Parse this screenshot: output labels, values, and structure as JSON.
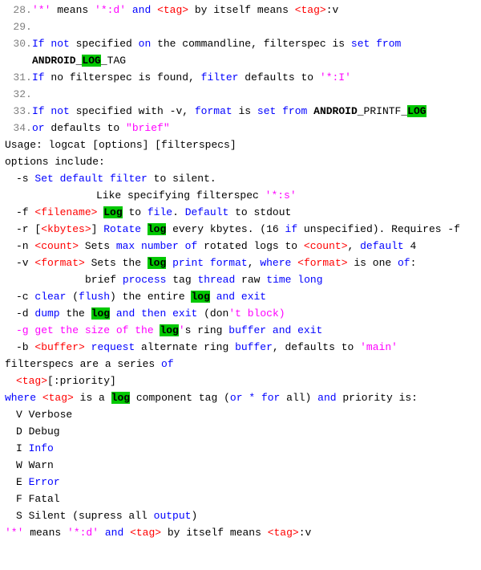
{
  "lines": [
    {
      "num": "28",
      "seg": [
        {
          "c": "str",
          "t": "'*'"
        },
        {
          "c": "plain",
          "t": " means "
        },
        {
          "c": "str",
          "t": "'*:d'"
        },
        {
          "c": "plain",
          "t": " "
        },
        {
          "c": "kw",
          "t": "and"
        },
        {
          "c": "plain",
          "t": " "
        },
        {
          "c": "tag",
          "t": "<tag>"
        },
        {
          "c": "plain",
          "t": " by itself means "
        },
        {
          "c": "tag",
          "t": "<tag>"
        },
        {
          "c": "plain",
          "t": ":v"
        }
      ]
    },
    {
      "num": "29",
      "seg": []
    },
    {
      "num": "30",
      "seg": [
        {
          "c": "kw",
          "t": "If"
        },
        {
          "c": "plain",
          "t": " "
        },
        {
          "c": "kw",
          "t": "not"
        },
        {
          "c": "plain",
          "t": " specified "
        },
        {
          "c": "kw",
          "t": "on"
        },
        {
          "c": "plain",
          "t": " the commandline, filterspec is "
        },
        {
          "c": "kw",
          "t": "set"
        },
        {
          "c": "plain",
          "t": " "
        },
        {
          "c": "kw",
          "t": "from"
        },
        {
          "c": "plain",
          "t": " "
        },
        {
          "c": "b",
          "t": "ANDROID_"
        },
        {
          "c": "hi",
          "t": "LOG"
        },
        {
          "c": "b",
          "t": "_"
        },
        {
          "c": "plain",
          "t": "TAG"
        }
      ]
    },
    {
      "num": "31",
      "seg": [
        {
          "c": "kw",
          "t": "If"
        },
        {
          "c": "plain",
          "t": " no filterspec is found, "
        },
        {
          "c": "kw",
          "t": "filter"
        },
        {
          "c": "plain",
          "t": " defaults to "
        },
        {
          "c": "str",
          "t": "'*:I'"
        }
      ]
    },
    {
      "num": "32",
      "seg": []
    },
    {
      "num": "33",
      "seg": [
        {
          "c": "kw",
          "t": "If"
        },
        {
          "c": "plain",
          "t": " "
        },
        {
          "c": "kw",
          "t": "not"
        },
        {
          "c": "plain",
          "t": " specified with -v, "
        },
        {
          "c": "kw",
          "t": "format"
        },
        {
          "c": "plain",
          "t": " is "
        },
        {
          "c": "kw",
          "t": "set"
        },
        {
          "c": "plain",
          "t": " "
        },
        {
          "c": "kw",
          "t": "from"
        },
        {
          "c": "plain",
          "t": " "
        },
        {
          "c": "b",
          "t": "ANDROID"
        },
        {
          "c": "plain",
          "t": "_PRINTF_"
        },
        {
          "c": "hi",
          "t": "LOG"
        }
      ]
    },
    {
      "num": "34",
      "seg": [
        {
          "c": "kw",
          "t": "or"
        },
        {
          "c": "plain",
          "t": " defaults to "
        },
        {
          "c": "dstr",
          "t": "\"brief\""
        }
      ]
    }
  ],
  "tail": [
    {
      "ind": "",
      "seg": [
        {
          "c": "plain",
          "t": "Usage: logcat [options] [filterspecs]"
        }
      ]
    },
    {
      "ind": "",
      "seg": [
        {
          "c": "plain",
          "t": "options include:"
        }
      ]
    },
    {
      "ind": "indent-1",
      "seg": [
        {
          "c": "plain",
          "t": "-s "
        },
        {
          "c": "kw",
          "t": "Set"
        },
        {
          "c": "plain",
          "t": " "
        },
        {
          "c": "kw",
          "t": "default"
        },
        {
          "c": "plain",
          "t": " "
        },
        {
          "c": "kw",
          "t": "filter"
        },
        {
          "c": "plain",
          "t": " to silent."
        }
      ]
    },
    {
      "ind": "indent-2",
      "seg": [
        {
          "c": "plain",
          "t": "Like specifying filterspec "
        },
        {
          "c": "str",
          "t": "'*:s'"
        }
      ]
    },
    {
      "ind": "indent-1",
      "seg": [
        {
          "c": "plain",
          "t": "-f "
        },
        {
          "c": "tag",
          "t": "<filename>"
        },
        {
          "c": "plain",
          "t": " "
        },
        {
          "c": "hi",
          "t": "Log"
        },
        {
          "c": "plain",
          "t": " to "
        },
        {
          "c": "kw",
          "t": "file"
        },
        {
          "c": "plain",
          "t": ". "
        },
        {
          "c": "kw",
          "t": "Default"
        },
        {
          "c": "plain",
          "t": " to stdout"
        }
      ]
    },
    {
      "ind": "indent-1",
      "seg": [
        {
          "c": "plain",
          "t": "-r ["
        },
        {
          "c": "tag",
          "t": "<kbytes>"
        },
        {
          "c": "plain",
          "t": "] "
        },
        {
          "c": "kw",
          "t": "Rotate"
        },
        {
          "c": "plain",
          "t": " "
        },
        {
          "c": "hi",
          "t": "log"
        },
        {
          "c": "plain",
          "t": " every kbytes. (16 "
        },
        {
          "c": "kw",
          "t": "if"
        },
        {
          "c": "plain",
          "t": " unspecified). Requires -f"
        }
      ]
    },
    {
      "ind": "indent-1",
      "seg": [
        {
          "c": "plain",
          "t": "-n "
        },
        {
          "c": "tag",
          "t": "<count>"
        },
        {
          "c": "plain",
          "t": " Sets "
        },
        {
          "c": "kw",
          "t": "max"
        },
        {
          "c": "plain",
          "t": " "
        },
        {
          "c": "kw",
          "t": "number"
        },
        {
          "c": "plain",
          "t": " "
        },
        {
          "c": "kw",
          "t": "of"
        },
        {
          "c": "plain",
          "t": " rotated logs to "
        },
        {
          "c": "tag",
          "t": "<count>"
        },
        {
          "c": "plain",
          "t": ", "
        },
        {
          "c": "kw",
          "t": "default"
        },
        {
          "c": "plain",
          "t": " 4"
        }
      ]
    },
    {
      "ind": "indent-1",
      "seg": [
        {
          "c": "plain",
          "t": "-v "
        },
        {
          "c": "tag",
          "t": "<format>"
        },
        {
          "c": "plain",
          "t": " Sets the "
        },
        {
          "c": "hi",
          "t": "log"
        },
        {
          "c": "plain",
          "t": " "
        },
        {
          "c": "kw",
          "t": "print"
        },
        {
          "c": "plain",
          "t": " "
        },
        {
          "c": "kw",
          "t": "format"
        },
        {
          "c": "plain",
          "t": ", "
        },
        {
          "c": "kw",
          "t": "where"
        },
        {
          "c": "plain",
          "t": " "
        },
        {
          "c": "tag",
          "t": "<format>"
        },
        {
          "c": "plain",
          "t": " is one "
        },
        {
          "c": "kw",
          "t": "of"
        },
        {
          "c": "plain",
          "t": ":"
        }
      ]
    },
    {
      "ind": "",
      "seg": [
        {
          "c": "plain",
          "t": " "
        }
      ]
    },
    {
      "ind": "indent-3",
      "seg": [
        {
          "c": "plain",
          "t": "brief "
        },
        {
          "c": "kw",
          "t": "process"
        },
        {
          "c": "plain",
          "t": " tag "
        },
        {
          "c": "kw",
          "t": "thread"
        },
        {
          "c": "plain",
          "t": " raw "
        },
        {
          "c": "kw",
          "t": "time"
        },
        {
          "c": "plain",
          "t": " "
        },
        {
          "c": "kw",
          "t": "long"
        }
      ]
    },
    {
      "ind": "",
      "seg": [
        {
          "c": "plain",
          "t": " "
        }
      ]
    },
    {
      "ind": "indent-1",
      "seg": [
        {
          "c": "plain",
          "t": "-c "
        },
        {
          "c": "kw",
          "t": "clear"
        },
        {
          "c": "plain",
          "t": " ("
        },
        {
          "c": "kw",
          "t": "flush"
        },
        {
          "c": "plain",
          "t": ") the entire "
        },
        {
          "c": "hi",
          "t": "log"
        },
        {
          "c": "plain",
          "t": " "
        },
        {
          "c": "kw",
          "t": "and"
        },
        {
          "c": "plain",
          "t": " "
        },
        {
          "c": "kw",
          "t": "exit"
        }
      ]
    },
    {
      "ind": "indent-1",
      "seg": [
        {
          "c": "plain",
          "t": "-d "
        },
        {
          "c": "kw",
          "t": "dump"
        },
        {
          "c": "plain",
          "t": " the "
        },
        {
          "c": "hi",
          "t": "log"
        },
        {
          "c": "plain",
          "t": " "
        },
        {
          "c": "kw",
          "t": "and"
        },
        {
          "c": "plain",
          "t": " "
        },
        {
          "c": "kw",
          "t": "then"
        },
        {
          "c": "plain",
          "t": " "
        },
        {
          "c": "kw",
          "t": "exit"
        },
        {
          "c": "plain",
          "t": " (don"
        },
        {
          "c": "str",
          "t": "'t block)"
        }
      ]
    },
    {
      "ind": "indent-1",
      "seg": [
        {
          "c": "str",
          "t": "-g get the size of the "
        },
        {
          "c": "hi",
          "t": "log"
        },
        {
          "c": "str",
          "t": "'"
        },
        {
          "c": "plain",
          "t": "s ring "
        },
        {
          "c": "kw",
          "t": "buffer"
        },
        {
          "c": "plain",
          "t": " "
        },
        {
          "c": "kw",
          "t": "and"
        },
        {
          "c": "plain",
          "t": " "
        },
        {
          "c": "kw",
          "t": "exit"
        }
      ]
    },
    {
      "ind": "indent-1",
      "seg": [
        {
          "c": "plain",
          "t": "-b "
        },
        {
          "c": "tag",
          "t": "<buffer>"
        },
        {
          "c": "plain",
          "t": " "
        },
        {
          "c": "kw",
          "t": "request"
        },
        {
          "c": "plain",
          "t": " alternate ring "
        },
        {
          "c": "kw",
          "t": "buffer"
        },
        {
          "c": "plain",
          "t": ", defaults to "
        },
        {
          "c": "str",
          "t": "'main'"
        }
      ]
    },
    {
      "ind": "",
      "seg": [
        {
          "c": "plain",
          "t": "filterspecs are a series "
        },
        {
          "c": "kw",
          "t": "of"
        }
      ]
    },
    {
      "ind": "indent-1",
      "seg": [
        {
          "c": "tag",
          "t": "<tag>"
        },
        {
          "c": "plain",
          "t": "[:priority]"
        }
      ]
    },
    {
      "ind": "",
      "seg": [
        {
          "c": "plain",
          "t": " "
        }
      ]
    },
    {
      "ind": "",
      "seg": [
        {
          "c": "kw",
          "t": "where"
        },
        {
          "c": "plain",
          "t": " "
        },
        {
          "c": "tag",
          "t": "<tag>"
        },
        {
          "c": "plain",
          "t": " is a "
        },
        {
          "c": "hi",
          "t": "log"
        },
        {
          "c": "plain",
          "t": " component tag ("
        },
        {
          "c": "kw",
          "t": "or"
        },
        {
          "c": "plain",
          "t": " "
        },
        {
          "c": "kw",
          "t": "*"
        },
        {
          "c": "plain",
          "t": " "
        },
        {
          "c": "kw",
          "t": "for"
        },
        {
          "c": "plain",
          "t": " all) "
        },
        {
          "c": "kw",
          "t": "and"
        },
        {
          "c": "plain",
          "t": " priority is:"
        }
      ]
    },
    {
      "ind": "indent-1",
      "seg": [
        {
          "c": "plain",
          "t": "V Verbose"
        }
      ]
    },
    {
      "ind": "indent-1",
      "seg": [
        {
          "c": "plain",
          "t": "D Debug"
        }
      ]
    },
    {
      "ind": "indent-1",
      "seg": [
        {
          "c": "plain",
          "t": "I "
        },
        {
          "c": "kw",
          "t": "Info"
        }
      ]
    },
    {
      "ind": "indent-1",
      "seg": [
        {
          "c": "plain",
          "t": "W Warn"
        }
      ]
    },
    {
      "ind": "indent-1",
      "seg": [
        {
          "c": "plain",
          "t": "E "
        },
        {
          "c": "kw",
          "t": "Error"
        }
      ]
    },
    {
      "ind": "indent-1",
      "seg": [
        {
          "c": "plain",
          "t": "F Fatal"
        }
      ]
    },
    {
      "ind": "indent-1",
      "seg": [
        {
          "c": "plain",
          "t": "S Silent (supress all "
        },
        {
          "c": "kw",
          "t": "output"
        },
        {
          "c": "plain",
          "t": ")"
        }
      ]
    },
    {
      "ind": "",
      "seg": [
        {
          "c": "plain",
          "t": " "
        }
      ]
    },
    {
      "ind": "",
      "seg": [
        {
          "c": "str",
          "t": "'*'"
        },
        {
          "c": "plain",
          "t": " means "
        },
        {
          "c": "str",
          "t": "'*:d'"
        },
        {
          "c": "plain",
          "t": " "
        },
        {
          "c": "kw",
          "t": "and"
        },
        {
          "c": "plain",
          "t": " "
        },
        {
          "c": "tag",
          "t": "<tag>"
        },
        {
          "c": "plain",
          "t": " by itself means "
        },
        {
          "c": "tag",
          "t": "<tag>"
        },
        {
          "c": "plain",
          "t": ":v"
        }
      ]
    }
  ]
}
